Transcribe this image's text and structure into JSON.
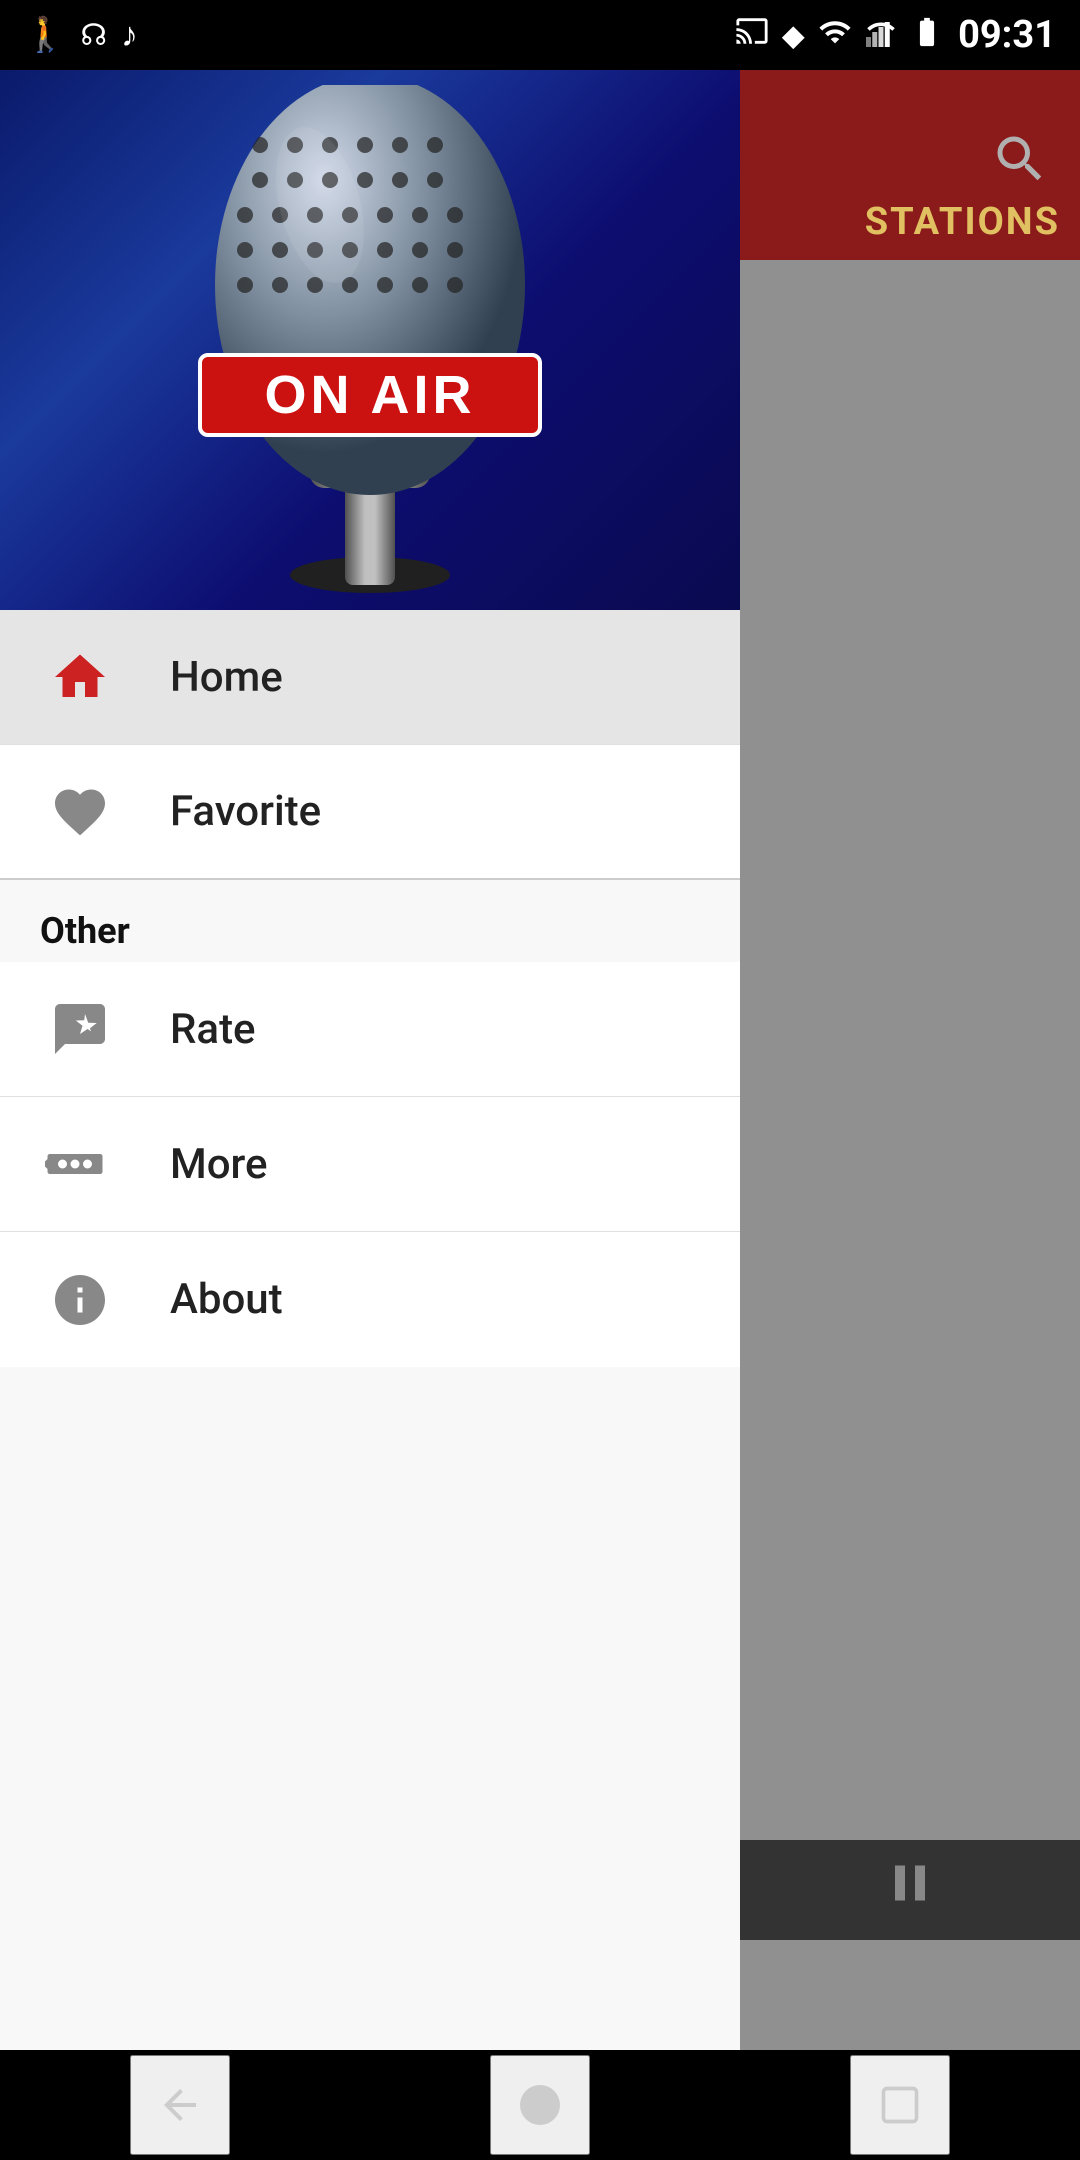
{
  "statusBar": {
    "time": "09:31",
    "icons": [
      "cast",
      "location",
      "wifi",
      "signal",
      "battery"
    ]
  },
  "hero": {
    "text": "ON AIR",
    "altText": "Radio microphone with ON AIR sign"
  },
  "menu": {
    "items": [
      {
        "id": "home",
        "label": "Home",
        "icon": "home",
        "active": true
      },
      {
        "id": "favorite",
        "label": "Favorite",
        "icon": "heart",
        "active": false
      }
    ],
    "sectionHeader": "Other",
    "otherItems": [
      {
        "id": "rate",
        "label": "Rate",
        "icon": "rate"
      },
      {
        "id": "more",
        "label": "More",
        "icon": "more"
      },
      {
        "id": "about",
        "label": "About",
        "icon": "info"
      }
    ]
  },
  "rightPanel": {
    "searchIconLabel": "search",
    "title": "STATIONS"
  },
  "playerBar": {
    "pauseLabel": "⏸"
  },
  "navBar": {
    "back": "◁",
    "home": "●",
    "recent": "▢"
  }
}
